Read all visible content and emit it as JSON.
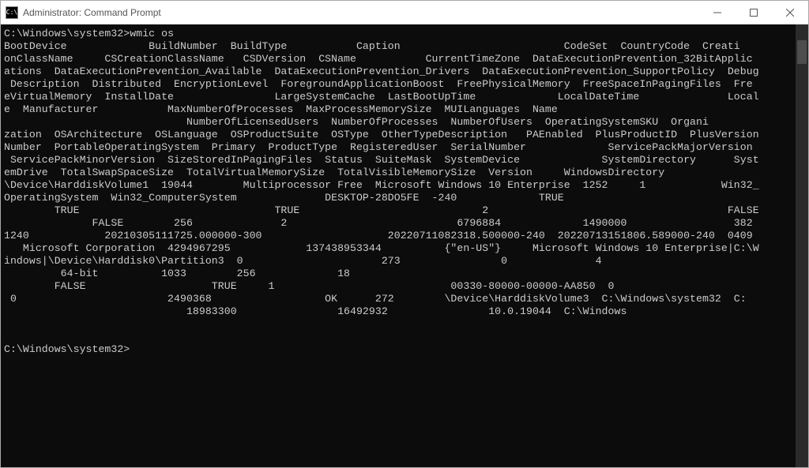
{
  "title": "Administrator: Command Prompt",
  "prompt1": "C:\\Windows\\system32>",
  "command": "wmic os",
  "headers_line1": "BootDevice             BuildNumber  BuildType           Caption                          CodeSet  CountryCode  Creati",
  "headers_line2": "onClassName     CSCreationClassName   CSDVersion  CSName           CurrentTimeZone  DataExecutionPrevention_32BitApplic",
  "headers_line3": "ations  DataExecutionPrevention_Available  DataExecutionPrevention_Drivers  DataExecutionPrevention_SupportPolicy  Debug",
  "headers_line4": " Description  Distributed  EncryptionLevel  ForegroundApplicationBoost  FreePhysicalMemory  FreeSpaceInPagingFiles  Fre",
  "headers_line5": "eVirtualMemory  InstallDate                LargeSystemCache  LastBootUpTime             LocalDateTime              Local",
  "headers_line6": "e  Manufacturer           MaxNumberOfProcesses  MaxProcessMemorySize  MUILanguages  Name",
  "headers_line7": "                             NumberOfLicensedUsers  NumberOfProcesses  NumberOfUsers  OperatingSystemSKU  Organi",
  "headers_line8": "zation  OSArchitecture  OSLanguage  OSProductSuite  OSType  OtherTypeDescription   PAEnabled  PlusProductID  PlusVersion",
  "headers_line9": "Number  PortableOperatingSystem  Primary  ProductType  RegisteredUser  SerialNumber             ServicePackMajorVersion ",
  "headers_line10": " ServicePackMinorVersion  SizeStoredInPagingFiles  Status  SuiteMask  SystemDevice             SystemDirectory      Syst",
  "headers_line11": "emDrive  TotalSwapSpaceSize  TotalVirtualMemorySize  TotalVisibleMemorySize  Version     WindowsDirectory",
  "data_line1": "\\Device\\HarddiskVolume1  19044        Multiprocessor Free  Microsoft Windows 10 Enterprise  1252     1            Win32_",
  "data_line2": "OperatingSystem  Win32_ComputerSystem              DESKTOP-28DO5FE  -240             TRUE",
  "data_line3": "        TRUE                               TRUE                             2                                      FALSE",
  "data_line4": "              FALSE        256              2                           6796884             1490000                 382",
  "data_line5": "1240            20210305111725.000000-300                    20220711082318.500000-240  20220713151806.589000-240  0409 ",
  "data_line6": "   Microsoft Corporation  4294967295            137438953344          {\"en-US\"}     Microsoft Windows 10 Enterprise|C:\\W",
  "data_line7": "indows|\\Device\\Harddisk0\\Partition3  0                      273                0              4",
  "data_line8": "         64-bit          1033        256             18",
  "data_line9": "        FALSE                    TRUE     1                            00330-80000-00000-AA850  0",
  "data_line10": " 0                        2490368                  OK      272        \\Device\\HarddiskVolume3  C:\\Windows\\system32  C:",
  "data_line11": "                             18983300                16492932                10.0.19044  C:\\Windows",
  "prompt2": "C:\\Windows\\system32>"
}
